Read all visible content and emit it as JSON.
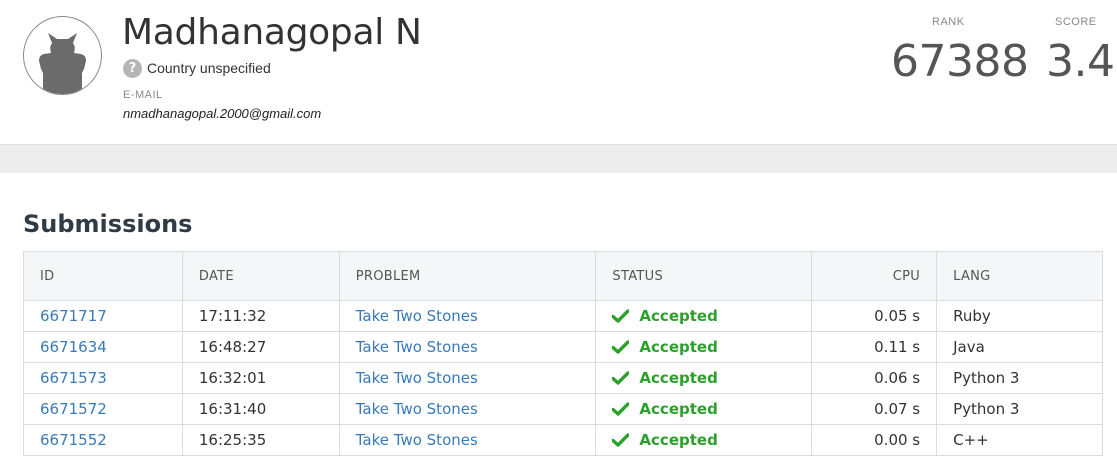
{
  "profile": {
    "name": "Madhanagopal N",
    "country": "Country unspecified",
    "email_label": "E-MAIL",
    "email": "nmadhanagopal.2000@gmail.com"
  },
  "stats": {
    "rank_label": "RANK",
    "rank_value": "67388",
    "score_label": "SCORE",
    "score_value": "3.4"
  },
  "section_title": "Submissions",
  "table": {
    "headers": {
      "id": "ID",
      "date": "DATE",
      "problem": "PROBLEM",
      "status": "STATUS",
      "cpu": "CPU",
      "lang": "LANG"
    },
    "rows": [
      {
        "id": "6671717",
        "date": "17:11:32",
        "problem": "Take Two Stones",
        "status": "Accepted",
        "cpu": "0.05 s",
        "lang": "Ruby"
      },
      {
        "id": "6671634",
        "date": "16:48:27",
        "problem": "Take Two Stones",
        "status": "Accepted",
        "cpu": "0.11 s",
        "lang": "Java"
      },
      {
        "id": "6671573",
        "date": "16:32:01",
        "problem": "Take Two Stones",
        "status": "Accepted",
        "cpu": "0.06 s",
        "lang": "Python 3"
      },
      {
        "id": "6671572",
        "date": "16:31:40",
        "problem": "Take Two Stones",
        "status": "Accepted",
        "cpu": "0.07 s",
        "lang": "Python 3"
      },
      {
        "id": "6671552",
        "date": "16:25:35",
        "problem": "Take Two Stones",
        "status": "Accepted",
        "cpu": "0.00 s",
        "lang": "C++"
      }
    ]
  },
  "colors": {
    "link": "#3a7ab8",
    "accepted": "#2ba02b",
    "band": "#ececec"
  },
  "icons": {
    "avatar": "default-avatar-icon",
    "country": "question-circle-icon",
    "status": "checkmark-icon"
  }
}
